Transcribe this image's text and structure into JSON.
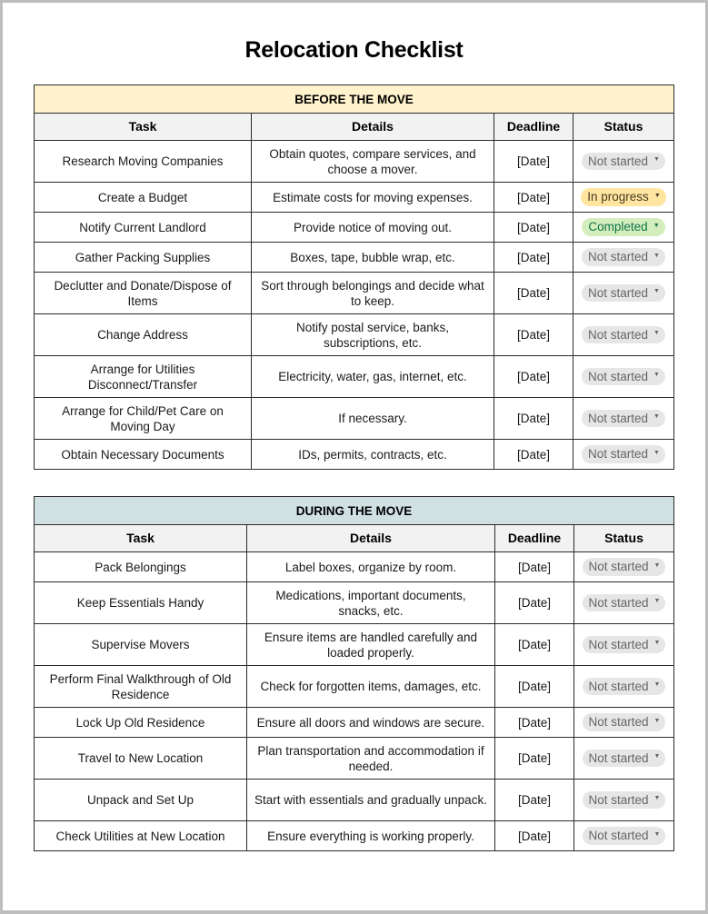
{
  "title": "Relocation Checklist",
  "status_styles": {
    "Not started": {
      "bg": "#e6e6e6",
      "fg": "#666666"
    },
    "In progress": {
      "bg": "#ffe5a0",
      "fg": "#473821"
    },
    "Completed": {
      "bg": "#d4edbc",
      "fg": "#11734b"
    }
  },
  "sections": [
    {
      "heading": "BEFORE THE MOVE",
      "band_color": "#fff2cc",
      "columns": [
        "Task",
        "Details",
        "Deadline",
        "Status"
      ],
      "rows": [
        {
          "task": "Research Moving Companies",
          "details": "Obtain quotes, compare services, and choose a mover.",
          "deadline": "[Date]",
          "status": "Not started"
        },
        {
          "task": "Create a Budget",
          "details": "Estimate costs for moving expenses.",
          "deadline": "[Date]",
          "status": "In progress"
        },
        {
          "task": "Notify Current Landlord",
          "details": "Provide notice of moving out.",
          "deadline": "[Date]",
          "status": "Completed"
        },
        {
          "task": "Gather Packing Supplies",
          "details": "Boxes, tape, bubble wrap, etc.",
          "deadline": "[Date]",
          "status": "Not started"
        },
        {
          "task": "Declutter and Donate/Dispose of Items",
          "details": "Sort through belongings and decide what to keep.",
          "deadline": "[Date]",
          "status": "Not started"
        },
        {
          "task": "Change Address",
          "details": "Notify postal service, banks, subscriptions, etc.",
          "deadline": "[Date]",
          "status": "Not started"
        },
        {
          "task": "Arrange for Utilities Disconnect/Transfer",
          "details": "Electricity, water, gas, internet, etc.",
          "deadline": "[Date]",
          "status": "Not started"
        },
        {
          "task": "Arrange for Child/Pet Care on Moving Day",
          "details": "If necessary.",
          "deadline": "[Date]",
          "status": "Not started"
        },
        {
          "task": "Obtain Necessary Documents",
          "details": "IDs, permits, contracts, etc.",
          "deadline": "[Date]",
          "status": "Not started"
        }
      ]
    },
    {
      "heading": "DURING THE MOVE",
      "band_color": "#d0e0e3",
      "columns": [
        "Task",
        "Details",
        "Deadline",
        "Status"
      ],
      "rows": [
        {
          "task": "Pack Belongings",
          "details": "Label boxes, organize by room.",
          "deadline": "[Date]",
          "status": "Not started"
        },
        {
          "task": "Keep Essentials Handy",
          "details": "Medications, important documents, snacks, etc.",
          "deadline": "[Date]",
          "status": "Not started"
        },
        {
          "task": "Supervise Movers",
          "details": "Ensure items are handled carefully and loaded properly.",
          "deadline": "[Date]",
          "status": "Not started"
        },
        {
          "task": "Perform Final Walkthrough of Old Residence",
          "details": "Check for forgotten items, damages, etc.",
          "deadline": "[Date]",
          "status": "Not started"
        },
        {
          "task": "Lock Up Old Residence",
          "details": "Ensure all doors and windows are secure.",
          "deadline": "[Date]",
          "status": "Not started"
        },
        {
          "task": "Travel to New Location",
          "details": "Plan transportation and accommodation if needed.",
          "deadline": "[Date]",
          "status": "Not started"
        },
        {
          "task": "Unpack and Set Up",
          "details": "Start with essentials and gradually unpack.",
          "deadline": "[Date]",
          "status": "Not started"
        },
        {
          "task": "Check Utilities at New Location",
          "details": "Ensure everything is working properly.",
          "deadline": "[Date]",
          "status": "Not started"
        }
      ]
    }
  ]
}
